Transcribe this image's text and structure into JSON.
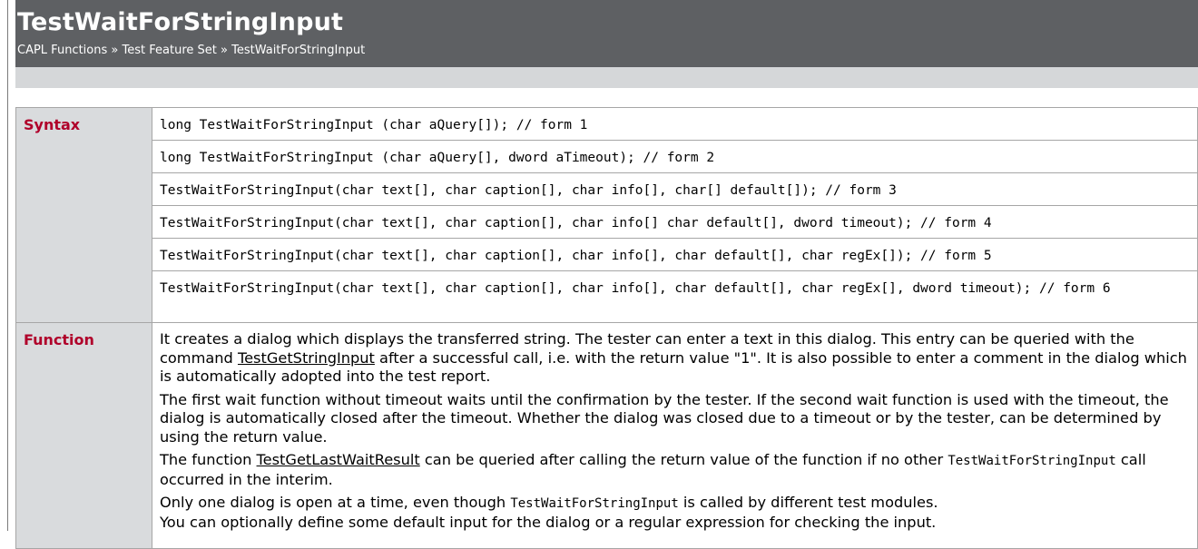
{
  "header": {
    "title": "TestWaitForStringInput",
    "breadcrumb": [
      "CAPL Functions",
      "Test Feature Set",
      "TestWaitForStringInput"
    ],
    "separator": "»"
  },
  "syntax": {
    "label": "Syntax",
    "forms": [
      "long TestWaitForStringInput (char aQuery[]); // form 1",
      "long TestWaitForStringInput (char aQuery[], dword aTimeout); // form 2",
      "TestWaitForStringInput(char text[], char caption[], char info[], char[] default[]); // form 3",
      "TestWaitForStringInput(char text[], char caption[], char info[] char default[], dword timeout); // form 4",
      "TestWaitForStringInput(char text[], char caption[], char info[], char default[], char regEx[]); // form 5",
      "TestWaitForStringInput(char text[], char caption[], char info[], char default[], char regEx[], dword timeout); // form 6"
    ]
  },
  "function": {
    "label": "Function",
    "p1_a": "It creates a dialog which displays the transferred string. The tester can enter a text in this dialog. This entry can be queried with the command ",
    "p1_link": "TestGetStringInput",
    "p1_b": " after a successful call, i.e. with the return value \"1\". It is also possible to enter a comment in the dialog which is automatically adopted into the test report.",
    "p2": "The first wait function without timeout waits until the confirmation by the tester. If the second wait function is used with the timeout, the dialog is automatically closed after the timeout. Whether the dialog was closed due to a timeout or by the tester, can be determined by using the return value.",
    "p3_a": "The function ",
    "p3_link": "TestGetLastWaitResult",
    "p3_b": " can be queried after calling the return value of the function if no other ",
    "p3_code": "TestWaitForStringInput",
    "p3_c": " call occurred in the interim.",
    "p4_a": "Only one dialog is open at a time, even though ",
    "p4_code": "TestWaitForStringInput",
    "p4_b": " is called by different test modules.",
    "p5": "You can optionally define some default input for the dialog or a regular expression for checking the input."
  }
}
